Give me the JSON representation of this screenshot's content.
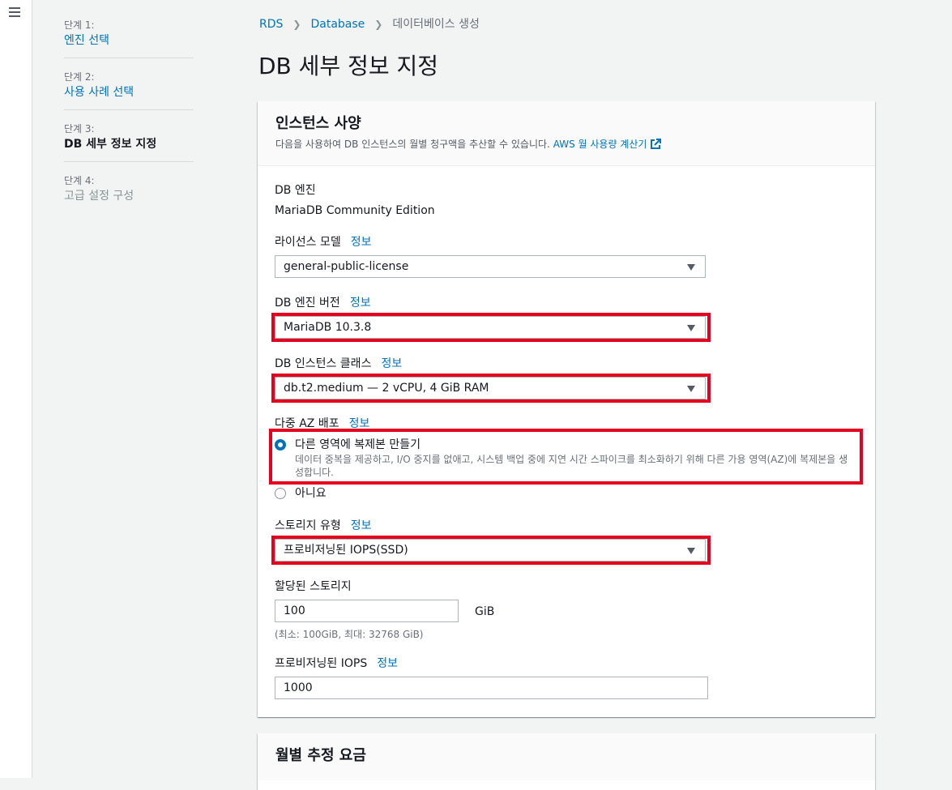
{
  "nav": {
    "steps": [
      {
        "num": "단계 1:",
        "title": "엔진 선택"
      },
      {
        "num": "단계 2:",
        "title": "사용 사례 선택"
      },
      {
        "num": "단계 3:",
        "title": "DB 세부 정보 지정"
      },
      {
        "num": "단계 4:",
        "title": "고급 설정 구성"
      }
    ]
  },
  "breadcrumb": [
    "RDS",
    "Database",
    "데이터베이스 생성"
  ],
  "page_title": "DB 세부 정보 지정",
  "instance": {
    "title": "인스턴스 사양",
    "description": "다음을 사용하여 DB 인스턴스의 월별 청구액을 추산할 수 있습니다.",
    "calculator_link": "AWS 월 사용량 계산기",
    "engine_label": "DB 엔진",
    "engine_value": "MariaDB Community Edition",
    "info": "정보",
    "license_label": "라이선스 모델",
    "license_value": "general-public-license",
    "version_label": "DB 엔진 버전",
    "version_value": "MariaDB 10.3.8",
    "class_label": "DB 인스턴스 클래스",
    "class_value": "db.t2.medium — 2 vCPU, 4 GiB RAM",
    "multi_az_label": "다중 AZ 배포",
    "multi_az_yes": "다른 영역에 복제본 만들기",
    "multi_az_yes_desc": "데이터 중복을 제공하고, I/O 중지를 없애고, 시스템 백업 중에 지연 시간 스파이크를 최소화하기 위해 다른 가용 영역(AZ)에 복제본을 생성합니다.",
    "multi_az_no": "아니요",
    "storage_type_label": "스토리지 유형",
    "storage_type_value": "프로비저닝된 IOPS(SSD)",
    "allocated_label": "할당된 스토리지",
    "allocated_value": "100",
    "allocated_unit": "GiB",
    "allocated_hint": "(최소: 100GiB, 최대: 32768 GiB)",
    "iops_label": "프로비저닝된 IOPS",
    "iops_value": "1000"
  },
  "monthly": {
    "title": "월별 추정 요금"
  },
  "colors": {
    "link": "#0073bb",
    "highlight": "#e6001f"
  }
}
